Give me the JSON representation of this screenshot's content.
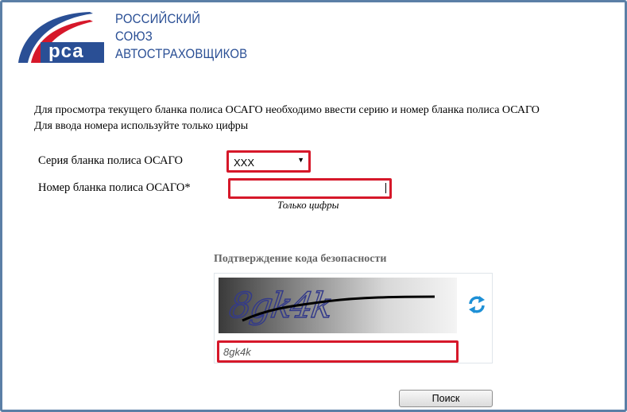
{
  "colors": {
    "brand_blue": "#2a4f95",
    "brand_red": "#d6182a",
    "highlight_red": "#d6182a"
  },
  "logo": {
    "mark_text": "рса",
    "lines": [
      "РОССИЙСКИЙ",
      "СОЮЗ",
      "АВТОСТРАХОВЩИКОВ"
    ]
  },
  "intro": {
    "line1": "Для просмотра текущего бланка полиса ОСАГО необходимо ввести серию и номер бланка полиса ОСАГО",
    "line2": "Для ввода номера используйте только цифры"
  },
  "form": {
    "series_label": "Серия бланка полиса ОСАГО",
    "series_value": "ХХХ",
    "number_label": "Номер бланка полиса ОСАГО*",
    "number_value": "",
    "number_hint": "Только цифры"
  },
  "captcha": {
    "title": "Подтверждение кода безопасности",
    "image_text": "8gk4k",
    "input_value": "8gk4k",
    "refresh_icon": "refresh-icon"
  },
  "search_button": "Поиск"
}
